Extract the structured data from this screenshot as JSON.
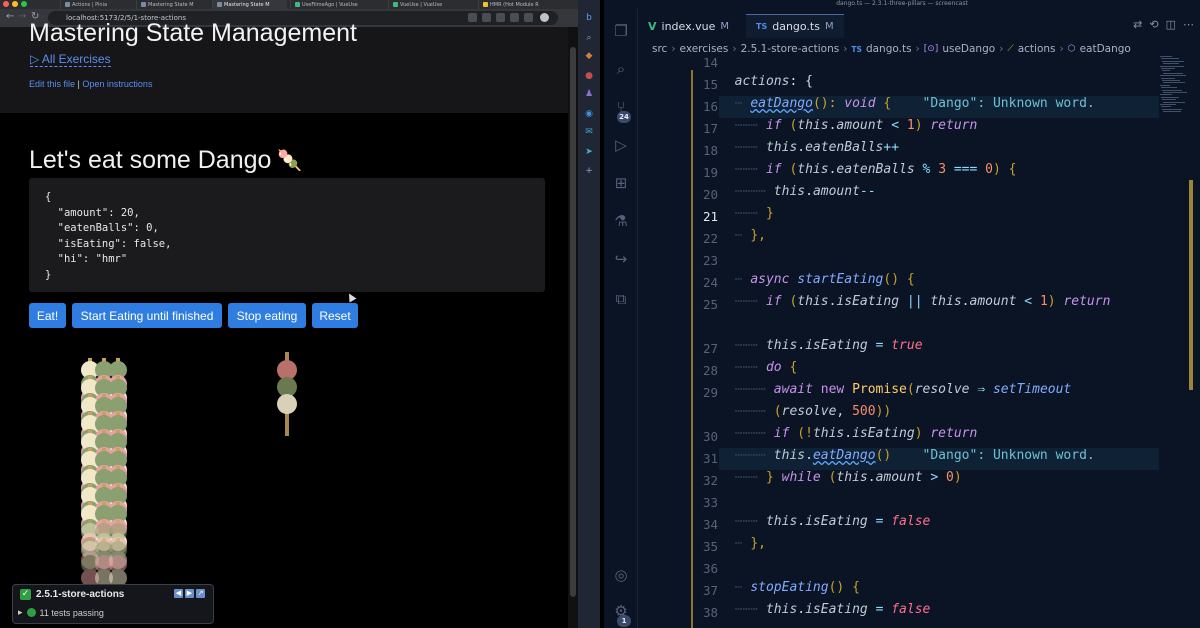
{
  "browser": {
    "tabs": [
      "Actions | Pinia",
      "Mastering State M",
      "Mastering State M",
      "UseFilmeAgo | VueUse",
      "VueUse | VueUse",
      "HMR (Hot Module R"
    ],
    "url": "localhost:5173/2/5/1-store-actions",
    "nav": {
      "back": "←",
      "forward": "→",
      "reload": "↻"
    }
  },
  "page": {
    "title": "Mastering State Management",
    "all_exercises": "▷ All Exercises",
    "edit_link": "Edit this file",
    "separator": "|",
    "instructions_link": "Open instructions",
    "heading": "Let's eat some Dango",
    "heading_emoji": "🍡",
    "json_text": "{\n  \"amount\": 20,\n  \"eatenBalls\": 0,\n  \"isEating\": false,\n  \"hi\": \"hmr\"\n}",
    "buttons": {
      "eat": "Eat!",
      "start": "Start Eating until finished",
      "stop": "Stop eating",
      "reset": "Reset"
    }
  },
  "tests": {
    "title": "2.5.1-store-actions",
    "check": "✓",
    "status": "11 tests passing",
    "expand": "▸"
  },
  "vscode": {
    "title": "dango.ts — 2.3.1-three-pillars — screencast",
    "activity_badges": {
      "source_control": "24",
      "accounts": "1"
    },
    "tabs": [
      {
        "name": "index.vue",
        "mod": "M"
      },
      {
        "name": "dango.ts",
        "mod": "M"
      }
    ],
    "breadcrumbs": {
      "p1": "src",
      "p2": "exercises",
      "p3": "2.5.1-store-actions",
      "p4": "dango.ts",
      "p5": "useDango",
      "p6": "actions",
      "p7": "eatDango"
    },
    "line_numbers": [
      "14",
      "15",
      "16",
      "17",
      "18",
      "19",
      "20",
      "21",
      "22",
      "23",
      "24",
      "25",
      "",
      "27",
      "28",
      "29",
      "",
      "30",
      "31",
      "32",
      "33",
      "34",
      "35",
      "36",
      "37",
      "38"
    ],
    "inline_note": "\"Dango\": Unknown word.",
    "code": {
      "l15_key": "actions",
      "l15_rest": ": {",
      "l16_fn": "eatDango",
      "l16_p": "(): ",
      "l16_type": "void",
      "l16_b": " {",
      "l17": "amount",
      "l18": "eatenBalls",
      "l19": "eatenBalls",
      "l20": "amount",
      "l24_async": "async",
      "l24_fn": "startEating",
      "l25_a": "isEating",
      "l25_b": "amount",
      "l27_a": "isEating",
      "l27_b": "true",
      "l28": "do",
      "l29_await": "await",
      "l29_new": "new",
      "l29_cls": "Promise",
      "l29_arg": "resolve",
      "l29_fn": "setTimeout",
      "l29b_arg": "resolve",
      "l29b_num": "500",
      "l30": "isEating",
      "l31": "eatDango",
      "l32_while": "while",
      "l32_prop": "amount",
      "l34_a": "isEating",
      "l34_b": "false",
      "l37_fn": "stopEating",
      "l38_a": "isEating",
      "l38_b": "false"
    }
  },
  "colors": {
    "button": "#2f7de1",
    "link": "#5a8ff0",
    "editor_bg": "#0b1424",
    "pass": "#2ea043"
  }
}
